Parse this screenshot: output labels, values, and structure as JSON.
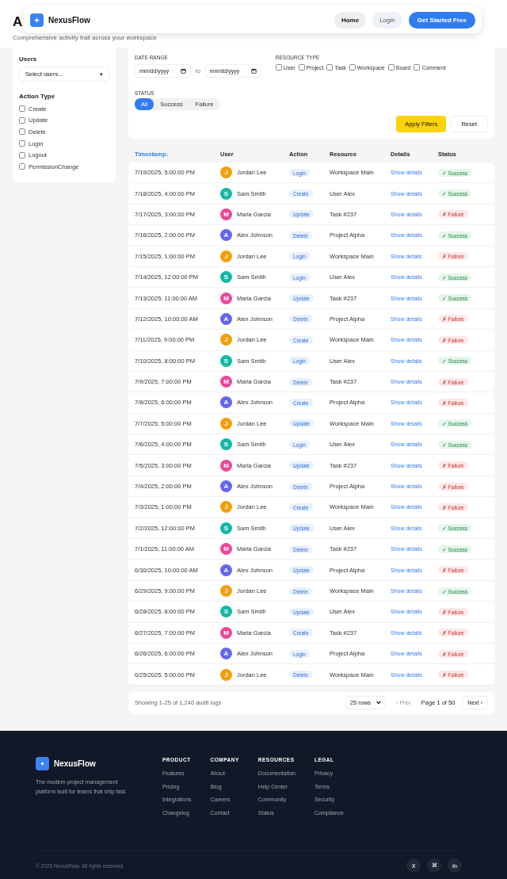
{
  "page": {
    "title_visible": "A",
    "subtitle": "Comprehensive activity trail across your workspace"
  },
  "nav": {
    "brand": "NexusFlow",
    "links": [
      {
        "label": "Home",
        "selected": true
      },
      {
        "label": "Login",
        "selected": false
      }
    ],
    "cta": "Get Started Free"
  },
  "sidebar": {
    "users_label": "Users",
    "users_select": "Select users...",
    "select_caret": "▾",
    "action_label": "Action Type",
    "actions": [
      {
        "label": "Create",
        "checked": false
      },
      {
        "label": "Update",
        "checked": false
      },
      {
        "label": "Delete",
        "checked": false
      },
      {
        "label": "Login",
        "checked": false
      },
      {
        "label": "Logout",
        "checked": false
      },
      {
        "label": "PermissionChange",
        "checked": false
      }
    ]
  },
  "filters": {
    "date_label": "DATE RANGE",
    "date_from": {
      "placeholder": "mm/dd/yyyy"
    },
    "date_sep": "to",
    "date_to": {
      "placeholder": "mm/dd/yyyy"
    },
    "resource_label": "RESOURCE TYPE",
    "resources": [
      {
        "label": "User",
        "checked": false
      },
      {
        "label": "Project",
        "checked": false
      },
      {
        "label": "Task",
        "checked": false
      },
      {
        "label": "Workspace",
        "checked": false
      },
      {
        "label": "Board",
        "checked": false
      },
      {
        "label": "Comment",
        "checked": false
      }
    ],
    "status_label": "STATUS",
    "status_options": [
      {
        "label": "All",
        "selected": true
      },
      {
        "label": "Success",
        "selected": false
      },
      {
        "label": "Failure",
        "selected": false
      }
    ],
    "apply": "Apply Filters",
    "reset": "Reset"
  },
  "table": {
    "columns": [
      {
        "label": "Timestamp",
        "sort": "↓",
        "sorted": true
      },
      {
        "label": "User",
        "sorted": false
      },
      {
        "label": "Action",
        "sorted": false
      },
      {
        "label": "Resource",
        "sorted": false
      },
      {
        "label": "Details",
        "sorted": false
      },
      {
        "label": "Status",
        "sorted": false
      }
    ],
    "rows": [
      {
        "timestamp": "7/19/2025, 5:00:00 PM",
        "initial": "J",
        "color": "#f59e0b",
        "user": "Jordan Lee",
        "action": "Login",
        "resource": "Workspace Main",
        "details": "Show details",
        "status": "✓ Success",
        "kind": "success"
      },
      {
        "timestamp": "7/18/2025, 4:00:00 PM",
        "initial": "S",
        "color": "#14b8a6",
        "user": "Sam Smith",
        "action": "Create",
        "resource": "User Alex",
        "details": "Show details",
        "status": "✓ Success",
        "kind": "success"
      },
      {
        "timestamp": "7/17/2025, 3:00:00 PM",
        "initial": "M",
        "color": "#ec4899",
        "user": "Maria Garcia",
        "action": "Update",
        "resource": "Task #237",
        "details": "Show details",
        "status": "✗ Failure",
        "kind": "failure"
      },
      {
        "timestamp": "7/16/2025, 2:00:00 PM",
        "initial": "A",
        "color": "#6366f1",
        "user": "Alex Johnson",
        "action": "Delete",
        "resource": "Project Alpha",
        "details": "Show details",
        "status": "✓ Success",
        "kind": "success"
      },
      {
        "timestamp": "7/15/2025, 1:00:00 PM",
        "initial": "J",
        "color": "#f59e0b",
        "user": "Jordan Lee",
        "action": "Login",
        "resource": "Workspace Main",
        "details": "Show details",
        "status": "✗ Failure",
        "kind": "failure"
      },
      {
        "timestamp": "7/14/2025, 12:00:00 PM",
        "initial": "S",
        "color": "#14b8a6",
        "user": "Sam Smith",
        "action": "Login",
        "resource": "User Alex",
        "details": "Show details",
        "status": "✓ Success",
        "kind": "success"
      },
      {
        "timestamp": "7/13/2025, 11:00:00 AM",
        "initial": "M",
        "color": "#ec4899",
        "user": "Maria Garcia",
        "action": "Update",
        "resource": "Task #237",
        "details": "Show details",
        "status": "✓ Success",
        "kind": "success"
      },
      {
        "timestamp": "7/12/2025, 10:00:00 AM",
        "initial": "A",
        "color": "#6366f1",
        "user": "Alex Johnson",
        "action": "Delete",
        "resource": "Project Alpha",
        "details": "Show details",
        "status": "✗ Failure",
        "kind": "failure"
      },
      {
        "timestamp": "7/11/2025, 9:00:00 PM",
        "initial": "J",
        "color": "#f59e0b",
        "user": "Jordan Lee",
        "action": "Create",
        "resource": "Workspace Main",
        "details": "Show details",
        "status": "✗ Failure",
        "kind": "failure"
      },
      {
        "timestamp": "7/10/2025, 8:00:00 PM",
        "initial": "S",
        "color": "#14b8a6",
        "user": "Sam Smith",
        "action": "Login",
        "resource": "User Alex",
        "details": "Show details",
        "status": "✓ Success",
        "kind": "success"
      },
      {
        "timestamp": "7/9/2025, 7:00:00 PM",
        "initial": "M",
        "color": "#ec4899",
        "user": "Maria Garcia",
        "action": "Delete",
        "resource": "Task #237",
        "details": "Show details",
        "status": "✗ Failure",
        "kind": "failure"
      },
      {
        "timestamp": "7/8/2025, 6:00:00 PM",
        "initial": "A",
        "color": "#6366f1",
        "user": "Alex Johnson",
        "action": "Create",
        "resource": "Project Alpha",
        "details": "Show details",
        "status": "✗ Failure",
        "kind": "failure"
      },
      {
        "timestamp": "7/7/2025, 5:00:00 PM",
        "initial": "J",
        "color": "#f59e0b",
        "user": "Jordan Lee",
        "action": "Update",
        "resource": "Workspace Main",
        "details": "Show details",
        "status": "✓ Success",
        "kind": "success"
      },
      {
        "timestamp": "7/6/2025, 4:00:00 PM",
        "initial": "S",
        "color": "#14b8a6",
        "user": "Sam Smith",
        "action": "Login",
        "resource": "User Alex",
        "details": "Show details",
        "status": "✓ Success",
        "kind": "success"
      },
      {
        "timestamp": "7/5/2025, 3:00:00 PM",
        "initial": "M",
        "color": "#ec4899",
        "user": "Maria Garcia",
        "action": "Update",
        "resource": "Task #237",
        "details": "Show details",
        "status": "✗ Failure",
        "kind": "failure"
      },
      {
        "timestamp": "7/4/2025, 2:00:00 PM",
        "initial": "A",
        "color": "#6366f1",
        "user": "Alex Johnson",
        "action": "Delete",
        "resource": "Project Alpha",
        "details": "Show details",
        "status": "✗ Failure",
        "kind": "failure"
      },
      {
        "timestamp": "7/3/2025, 1:00:00 PM",
        "initial": "J",
        "color": "#f59e0b",
        "user": "Jordan Lee",
        "action": "Create",
        "resource": "Workspace Main",
        "details": "Show details",
        "status": "✗ Failure",
        "kind": "failure"
      },
      {
        "timestamp": "7/2/2025, 12:00:00 PM",
        "initial": "S",
        "color": "#14b8a6",
        "user": "Sam Smith",
        "action": "Update",
        "resource": "User Alex",
        "details": "Show details",
        "status": "✓ Success",
        "kind": "success"
      },
      {
        "timestamp": "7/1/2025, 11:00:00 AM",
        "initial": "M",
        "color": "#ec4899",
        "user": "Maria Garcia",
        "action": "Delete",
        "resource": "Task #237",
        "details": "Show details",
        "status": "✓ Success",
        "kind": "success"
      },
      {
        "timestamp": "6/30/2025, 10:00:00 AM",
        "initial": "A",
        "color": "#6366f1",
        "user": "Alex Johnson",
        "action": "Update",
        "resource": "Project Alpha",
        "details": "Show details",
        "status": "✗ Failure",
        "kind": "failure"
      },
      {
        "timestamp": "6/29/2025, 9:00:00 PM",
        "initial": "J",
        "color": "#f59e0b",
        "user": "Jordan Lee",
        "action": "Delete",
        "resource": "Workspace Main",
        "details": "Show details",
        "status": "✓ Success",
        "kind": "success"
      },
      {
        "timestamp": "6/28/2025, 8:00:00 PM",
        "initial": "S",
        "color": "#14b8a6",
        "user": "Sam Smith",
        "action": "Update",
        "resource": "User Alex",
        "details": "Show details",
        "status": "✗ Failure",
        "kind": "failure"
      },
      {
        "timestamp": "6/27/2025, 7:00:00 PM",
        "initial": "M",
        "color": "#ec4899",
        "user": "Maria Garcia",
        "action": "Create",
        "resource": "Task #237",
        "details": "Show details",
        "status": "✗ Failure",
        "kind": "failure"
      },
      {
        "timestamp": "6/26/2025, 6:00:00 PM",
        "initial": "A",
        "color": "#6366f1",
        "user": "Alex Johnson",
        "action": "Login",
        "resource": "Project Alpha",
        "details": "Show details",
        "status": "✗ Failure",
        "kind": "failure"
      },
      {
        "timestamp": "6/25/2025, 5:00:00 PM",
        "initial": "J",
        "color": "#f59e0b",
        "user": "Jordan Lee",
        "action": "Delete",
        "resource": "Workspace Main",
        "details": "Show details",
        "status": "✗ Failure",
        "kind": "failure"
      }
    ]
  },
  "pagination": {
    "summary": "Showing 1-25 of 1,240 audit logs",
    "rows_select": "25 rows",
    "prev": {
      "label": "‹ Prev",
      "disabled": true
    },
    "page": "Page 1 of 50",
    "next": {
      "label": "Next ›",
      "disabled": false
    }
  },
  "footer": {
    "brand": "NexusFlow",
    "tagline": "The modern project management platform built for teams that ship fast.",
    "columns": [
      {
        "heading": "PRODUCT",
        "links": [
          "Features",
          "Pricing",
          "Integrations",
          "Changelog"
        ]
      },
      {
        "heading": "COMPANY",
        "links": [
          "About",
          "Blog",
          "Careers",
          "Contact"
        ]
      },
      {
        "heading": "RESOURCES",
        "links": [
          "Documentation",
          "Help Center",
          "Community",
          "Status"
        ]
      },
      {
        "heading": "LEGAL",
        "links": [
          "Privacy",
          "Terms",
          "Security",
          "Compliance"
        ]
      }
    ],
    "copyright": "© 2025 NexusFlow. All rights reserved.",
    "socials": [
      "X",
      "⌘",
      "in"
    ]
  }
}
